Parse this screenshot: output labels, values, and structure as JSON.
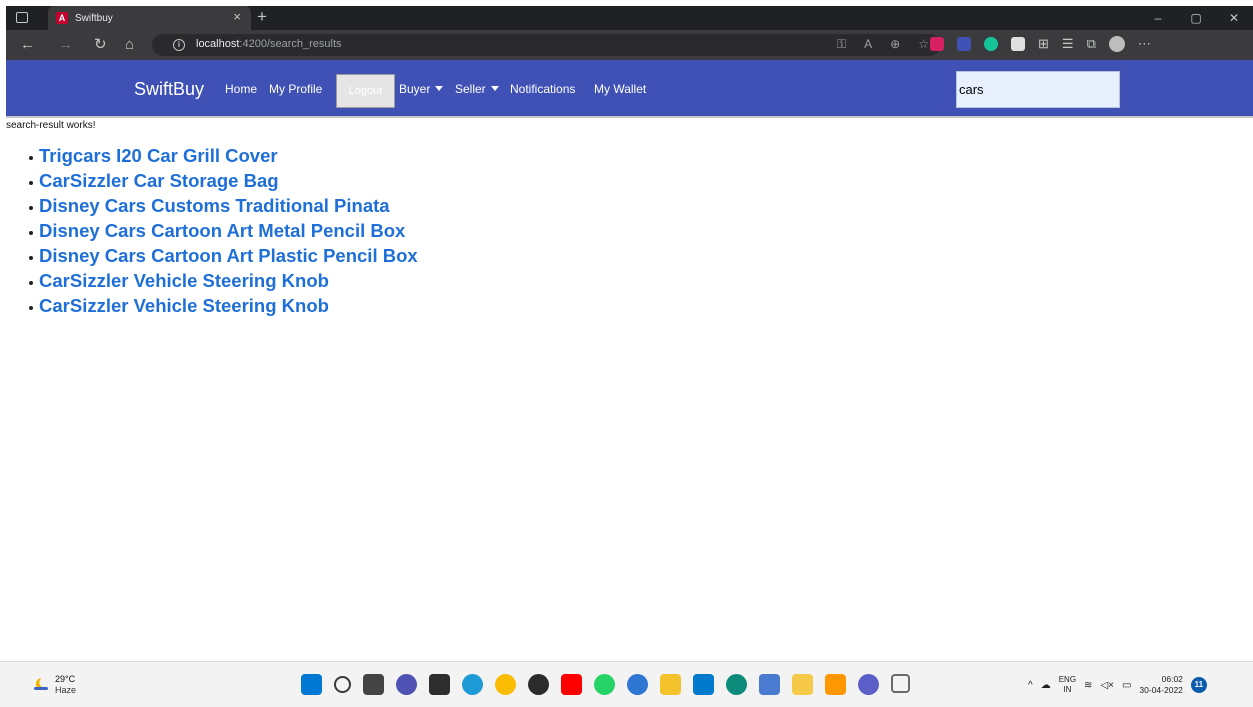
{
  "browser": {
    "tab_title": "Swiftbuy",
    "tab_favicon": "A",
    "tab_close": "×",
    "new_tab": "+",
    "url_host": "localhost",
    "url_rest": ":4200/search_results",
    "window_controls": [
      "–",
      "▢",
      "✕"
    ],
    "nav_icons": [
      "←",
      "→",
      "↻",
      "⌂"
    ],
    "address_icons": [
      "key-icon",
      "read-aloud-icon",
      "zoom-icon",
      "favorite-icon"
    ],
    "extensions": [
      {
        "name": "ublock-extension-icon",
        "color": "#d6205f"
      },
      {
        "name": "extension-blue-icon",
        "color": "#3f51b5"
      },
      {
        "name": "grammarly-extension-icon",
        "color": "#15c39a"
      },
      {
        "name": "extension-white-icon",
        "color": "#e0e0e0"
      }
    ]
  },
  "navbar": {
    "brand": "SwiftBuy",
    "links": {
      "home": "Home",
      "profile": "My Profile",
      "logout": "Logout",
      "buyer": "Buyer",
      "seller": "Seller",
      "notifications": "Notifications",
      "wallet": "My Wallet"
    },
    "search_value": "cars",
    "bg_color": "#3f51b5"
  },
  "content": {
    "works_text": "search-result works!",
    "results": [
      "Trigcars I20 Car Grill Cover",
      "CarSizzler Car Storage Bag",
      "Disney Cars Customs Traditional Pinata",
      "Disney Cars Cartoon Art Metal Pencil Box",
      "Disney Cars Cartoon Art Plastic Pencil Box",
      "CarSizzler Vehicle Steering Knob",
      "CarSizzler Vehicle Steering Knob"
    ],
    "link_color": "#1f6fd9"
  },
  "taskbar": {
    "weather_temp": "29°C",
    "weather_desc": "Haze",
    "apps": [
      {
        "name": "start-icon",
        "color": "#0078d4"
      },
      {
        "name": "search-icon",
        "color": "#3a3a3a"
      },
      {
        "name": "task-view-icon",
        "color": "#444444"
      },
      {
        "name": "chat-icon",
        "color": "#4f52b2"
      },
      {
        "name": "terminal-icon",
        "color": "#2d2d2d"
      },
      {
        "name": "edge-icon",
        "color": "#1e9bd7"
      },
      {
        "name": "chrome-icon",
        "color": "#fbbc04"
      },
      {
        "name": "app-icon",
        "color": "#2b2b2b"
      },
      {
        "name": "youtube-icon",
        "color": "#ff0000"
      },
      {
        "name": "whatsapp-icon",
        "color": "#25d366"
      },
      {
        "name": "postman-icon",
        "color": "#2f76d2"
      },
      {
        "name": "file-explorer-icon",
        "color": "#f4c22b"
      },
      {
        "name": "vscode-icon",
        "color": "#007acc"
      },
      {
        "name": "edge-dev-icon",
        "color": "#0c8a7a"
      },
      {
        "name": "app-icon-2",
        "color": "#4a7bd0"
      },
      {
        "name": "sticky-notes-icon",
        "color": "#f7c948"
      },
      {
        "name": "sublime-icon",
        "color": "#ff9800"
      },
      {
        "name": "teams-icon",
        "color": "#5b5fc7"
      },
      {
        "name": "git-icon",
        "color": "#6a6a6a"
      }
    ],
    "lang_top": "ENG",
    "lang_bottom": "IN",
    "time": "06:02",
    "date": "30-04-2022",
    "notification_count": "11"
  }
}
